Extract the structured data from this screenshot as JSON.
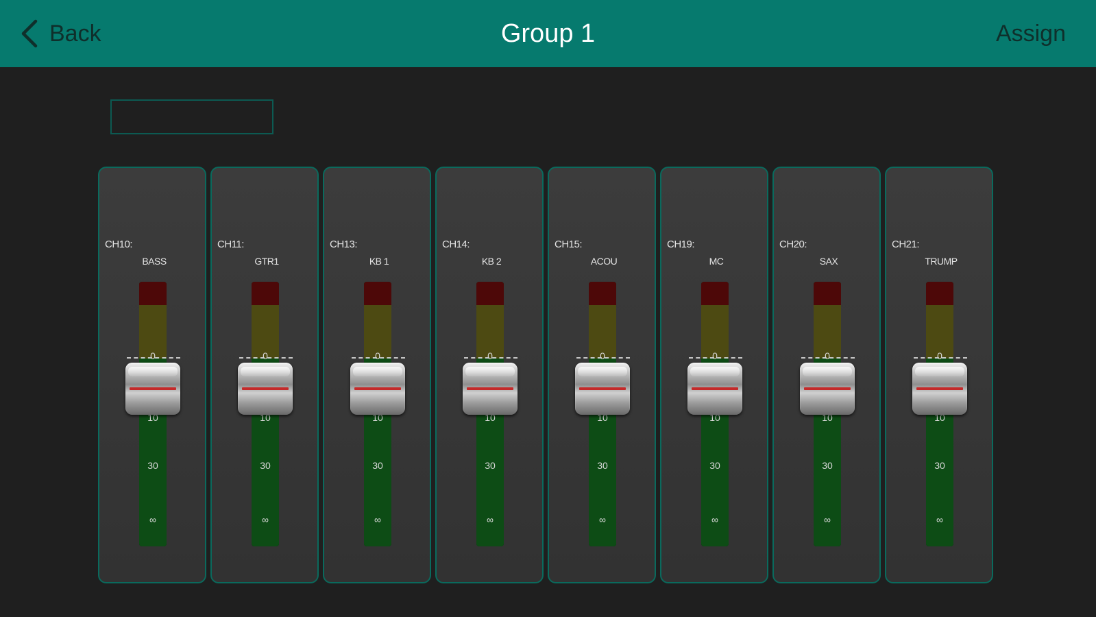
{
  "header": {
    "back_label": "Back",
    "title": "Group 1",
    "assign_label": "Assign"
  },
  "name_field": {
    "value": "",
    "placeholder": ""
  },
  "icons": {
    "back": "chevron-left-icon",
    "edit": "pencil-icon"
  },
  "colors": {
    "header_bg": "#067a6e",
    "strip_border": "#0a6a5d",
    "background": "#1f1f1f"
  },
  "fader_scale": {
    "zero": "0",
    "ten": "10",
    "thirty": "30",
    "inf": "∞"
  },
  "channels": [
    {
      "id": "CH10:",
      "name": "BASS"
    },
    {
      "id": "CH11:",
      "name": "GTR1"
    },
    {
      "id": "CH13:",
      "name": "KB 1"
    },
    {
      "id": "CH14:",
      "name": "KB 2"
    },
    {
      "id": "CH15:",
      "name": "ACOU"
    },
    {
      "id": "CH19:",
      "name": "MC"
    },
    {
      "id": "CH20:",
      "name": "SAX"
    },
    {
      "id": "CH21:",
      "name": "TRUMP"
    }
  ]
}
